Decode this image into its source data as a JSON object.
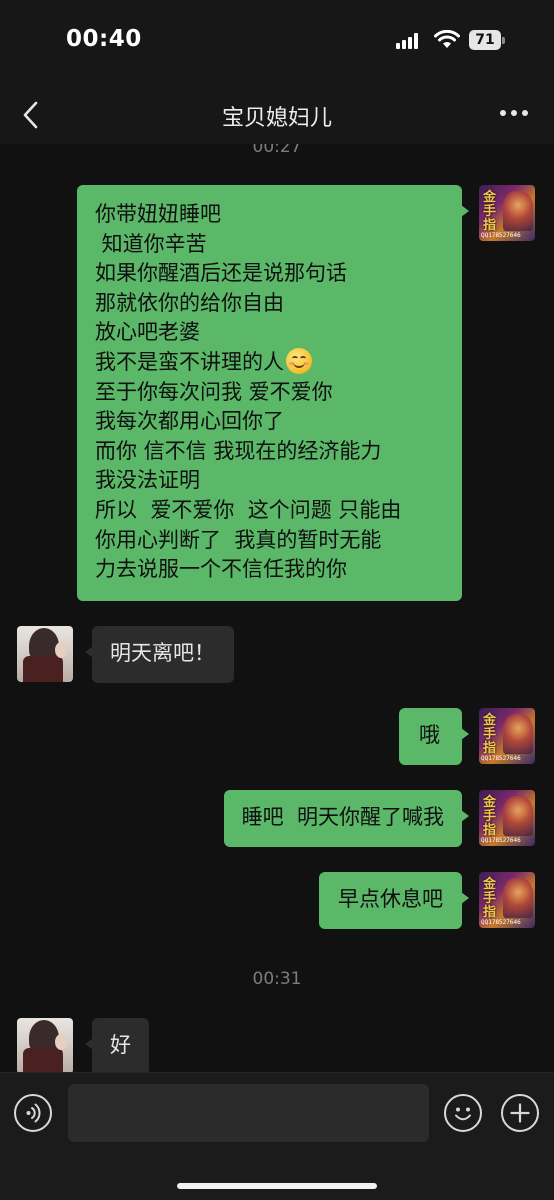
{
  "status_bar": {
    "time": "00:40",
    "battery_level": "71",
    "icons": [
      "signal-icon",
      "wifi-icon",
      "battery-icon"
    ]
  },
  "nav": {
    "title": "宝贝媳妇儿",
    "back_icon": "chevron-left-icon",
    "more_icon": "more-dots-icon"
  },
  "chat": {
    "timestamps": [
      "00:27",
      "00:31"
    ],
    "messages": [
      {
        "sender": "self",
        "lines": [
          "你带妞妞睡吧",
          " 知道你辛苦",
          "如果你醒酒后还是说那句话",
          "那就依你的给你自由",
          "放心吧老婆",
          "我不是蛮不讲理的人",
          "至于你每次问我 爱不爱你",
          "我每次都用心回你了",
          "而你 信不信 我现在的经济能力",
          "我没法证明",
          "所以  爱不爱你  这个问题 只能由",
          "你用心判断了  我真的暂时无能",
          "力去说服一个不信任我的你"
        ],
        "emoji": "smiling-face-emoji"
      },
      {
        "sender": "other",
        "text": "明天离吧！"
      },
      {
        "sender": "self",
        "text": "哦"
      },
      {
        "sender": "self",
        "text": "睡吧  明天你醒了喊我"
      },
      {
        "sender": "self",
        "text": "早点休息吧"
      },
      {
        "sender": "other",
        "text": "好"
      }
    ],
    "avatar_self_text": "金手指",
    "avatar_self_tag": "QQ178527646"
  },
  "input_bar": {
    "value": "",
    "voice_icon": "voice-icon",
    "emoji_icon": "emoji-icon",
    "plus_icon": "plus-icon"
  },
  "colors": {
    "background": "#111111",
    "bubble_out": "#5ab868",
    "bubble_in": "#2c2c2c",
    "bar": "#171717"
  }
}
